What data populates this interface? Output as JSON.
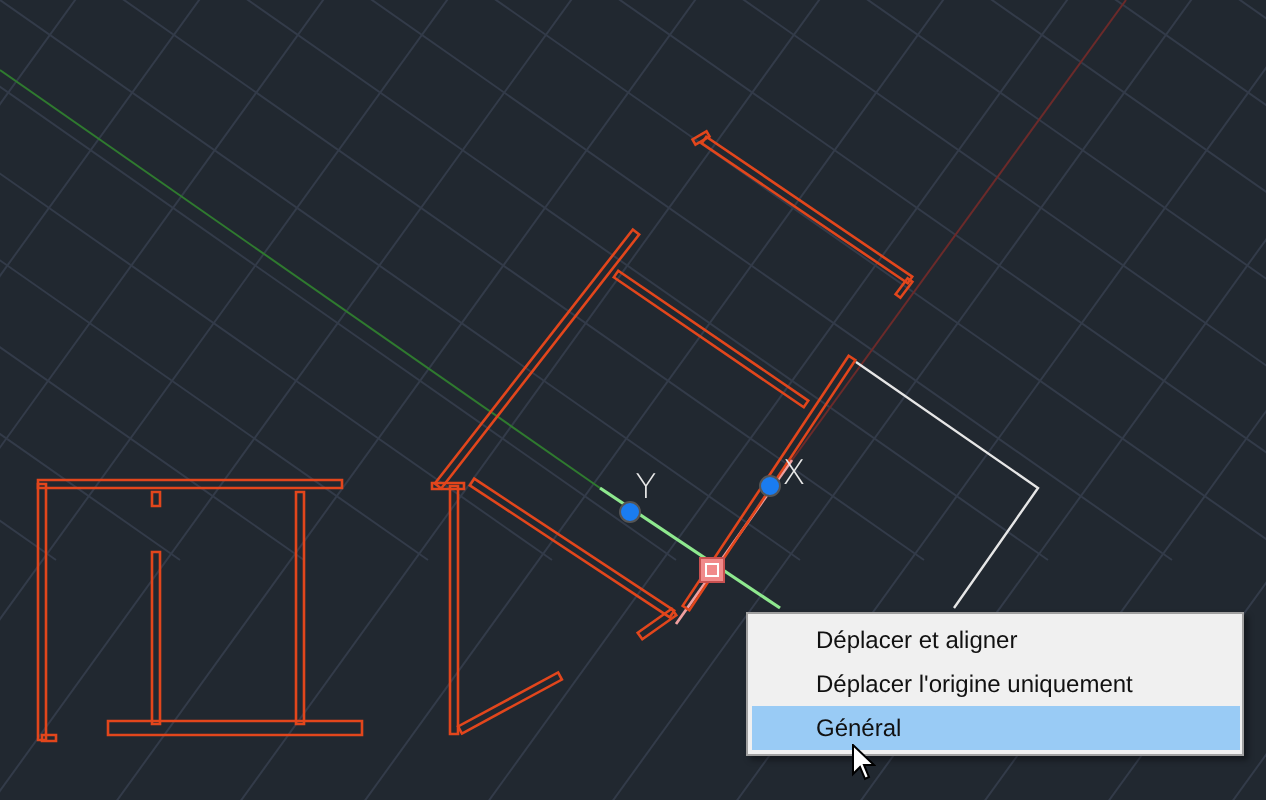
{
  "viewport": {
    "axis_labels": [
      {
        "kind": "y",
        "text": "Y"
      },
      {
        "kind": "x",
        "text": "X"
      }
    ]
  },
  "context_menu": {
    "items": [
      {
        "label": "Déplacer et aligner",
        "selected": false
      },
      {
        "label": "Déplacer l'origine uniquement",
        "selected": false
      },
      {
        "label": "Général",
        "selected": true
      }
    ]
  }
}
